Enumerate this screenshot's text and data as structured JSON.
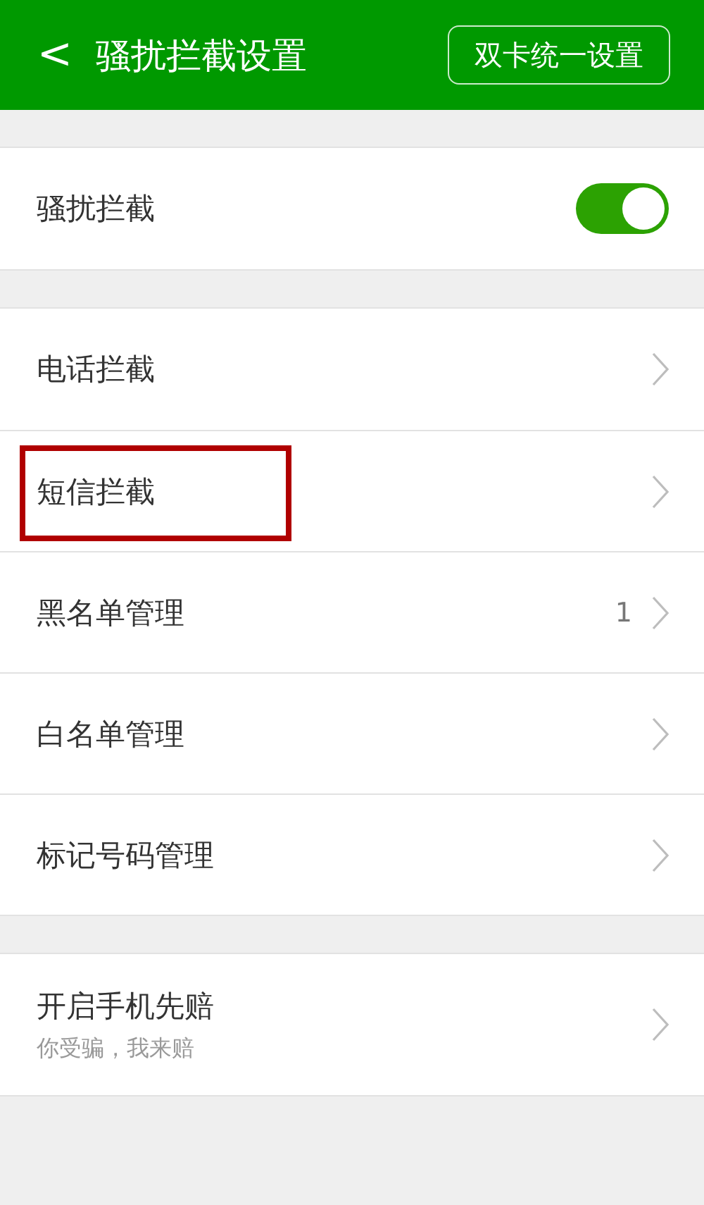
{
  "header": {
    "back": "<",
    "title": "骚扰拦截设置",
    "action": "双卡统一设置"
  },
  "master": {
    "label": "骚扰拦截",
    "on": true
  },
  "items": [
    {
      "label": "电话拦截",
      "highlighted": false
    },
    {
      "label": "短信拦截",
      "highlighted": true
    },
    {
      "label": "黑名单管理",
      "count": "1",
      "highlighted": false
    },
    {
      "label": "白名单管理",
      "highlighted": false
    },
    {
      "label": "标记号码管理",
      "highlighted": false
    }
  ],
  "compensation": {
    "label": "开启手机先赔",
    "subtitle": "你受骗，我来赔"
  }
}
